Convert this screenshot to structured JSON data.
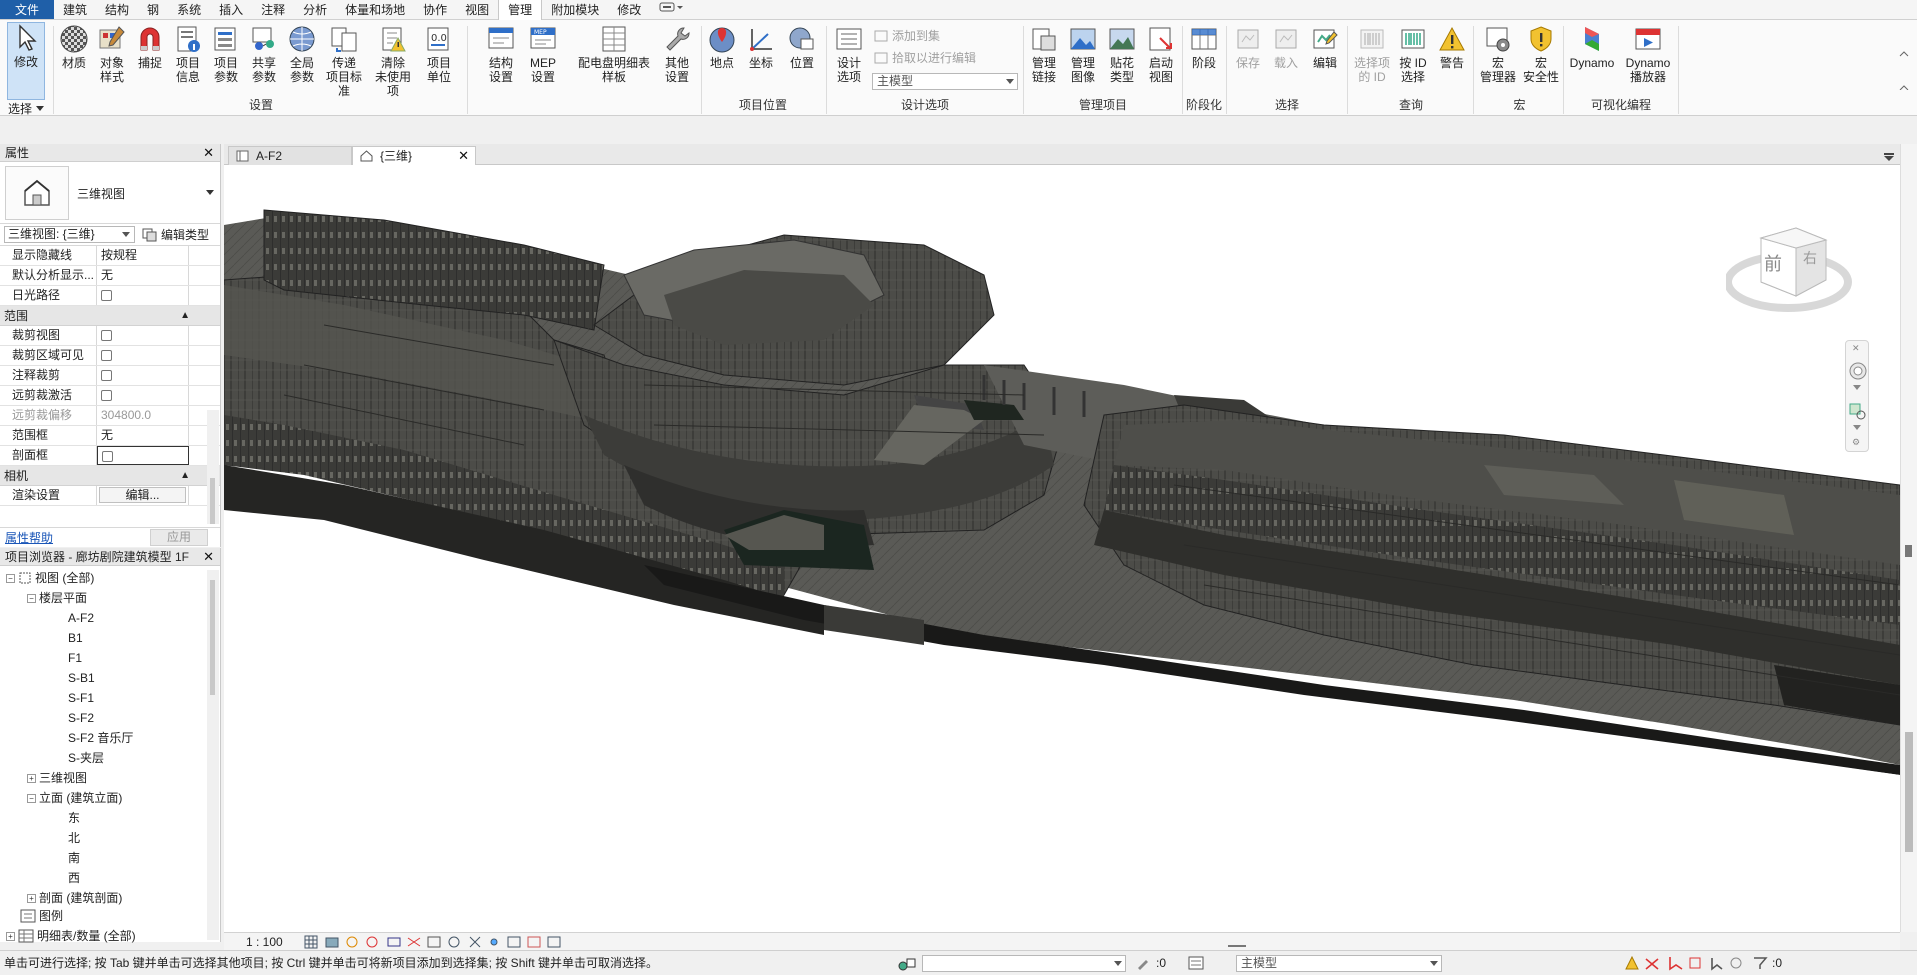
{
  "menu": {
    "tabs": [
      "文件",
      "建筑",
      "结构",
      "钢",
      "系统",
      "插入",
      "注释",
      "分析",
      "体量和场地",
      "协作",
      "视图",
      "管理",
      "附加模块",
      "修改"
    ],
    "active": "管理"
  },
  "ribbon": {
    "modify": {
      "label": "修改",
      "select_label": "选择"
    },
    "settings": [
      {
        "label": "材质"
      },
      {
        "label": "对象\n样式"
      },
      {
        "label": "捕捉"
      },
      {
        "label": "项目\n信息"
      },
      {
        "label": "项目\n参数"
      },
      {
        "label": "共享\n参数"
      },
      {
        "label": "全局\n参数"
      },
      {
        "label": "传递\n项目标准"
      },
      {
        "label": "清除\n未使用项"
      },
      {
        "label": "项目\n单位"
      }
    ],
    "settings_group": "设置",
    "mep": [
      {
        "label": "结构\n设置"
      },
      {
        "label": "MEP\n设置"
      },
      {
        "label": "配电盘明细表\n样板"
      },
      {
        "label": "其他\n设置"
      }
    ],
    "location": [
      {
        "label": "地点"
      },
      {
        "label": "坐标"
      },
      {
        "label": "位置"
      }
    ],
    "location_group": "项目位置",
    "design_option": {
      "label": "设计\n选项",
      "add_to_set": "添加到集",
      "pick_to_edit": "拾取以进行编辑",
      "combo_value": "主模型",
      "group": "设计选项"
    },
    "manage_project": [
      {
        "label": "管理\n链接"
      },
      {
        "label": "管理\n图像"
      },
      {
        "label": "贴花\n类型"
      },
      {
        "label": "启动\n视图"
      }
    ],
    "manage_project_group": "管理项目",
    "phasing": {
      "label": "阶段",
      "group": "阶段化"
    },
    "selection": [
      {
        "label": "保存"
      },
      {
        "label": "载入"
      },
      {
        "label": "编辑"
      }
    ],
    "selection_group": "选择",
    "inquiry": [
      {
        "label": "选择项\n的 ID"
      },
      {
        "label": "按 ID\n选择"
      },
      {
        "label": "警告"
      }
    ],
    "inquiry_group": "查询",
    "macros": [
      {
        "label": "宏\n管理器"
      },
      {
        "label": "宏\n安全性"
      }
    ],
    "macros_group": "宏",
    "visual": [
      {
        "label": "Dynamo"
      },
      {
        "label": "Dynamo\n播放器"
      }
    ],
    "visual_group": "可视化编程"
  },
  "properties": {
    "title": "属性",
    "type_name": "三维视图",
    "instance_selector": "三维视图: {三维}",
    "edit_type": "编辑类型",
    "rows_top": [
      {
        "key": "显示隐藏线",
        "value": "按规程"
      },
      {
        "key": "默认分析显示...",
        "value": "无"
      },
      {
        "key": "日光路径",
        "value": ""
      }
    ],
    "cat_extent": "范围",
    "rows_extent": [
      {
        "key": "裁剪视图",
        "value": ""
      },
      {
        "key": "裁剪区域可见",
        "value": ""
      },
      {
        "key": "注释裁剪",
        "value": ""
      },
      {
        "key": "远剪裁激活",
        "value": ""
      },
      {
        "key": "远剪裁偏移",
        "value": "304800.0"
      },
      {
        "key": "范围框",
        "value": "无"
      },
      {
        "key": "剖面框",
        "value": ""
      }
    ],
    "cat_camera": "相机",
    "rows_camera": [
      {
        "key": "渲染设置",
        "value": "编辑..."
      }
    ],
    "help": "属性帮助",
    "apply": "应用"
  },
  "browser": {
    "title": "项目浏览器 - 廊坊剧院建筑模型 1F",
    "root": "视图 (全部)",
    "floor_plans": "楼层平面",
    "plans": [
      "A-F2",
      "B1",
      "F1",
      "S-B1",
      "S-F1",
      "S-F2",
      "S-F2 音乐厅",
      "S-夹层"
    ],
    "views3d": "三维视图",
    "elevations": "立面 (建筑立面)",
    "elev_items": [
      "东",
      "北",
      "南",
      "西"
    ],
    "sections": "剖面 (建筑剖面)",
    "legends": "图例",
    "schedules": "明细表/数量 (全部)"
  },
  "view_tabs": [
    {
      "label": "A-F2"
    },
    {
      "label": "{三维}"
    }
  ],
  "viewcube": {
    "face": "前",
    "side": "右"
  },
  "view_bar": {
    "scale": "1 : 100"
  },
  "status": {
    "message": "单击可进行选择; 按 Tab 键并单击可选择其他项目; 按 Ctrl 键并单击可将新项目添加到选择集; 按 Shift 键并单击可取消选择。",
    "zero1": ":0",
    "model": "主模型",
    "zero2": ":0"
  }
}
